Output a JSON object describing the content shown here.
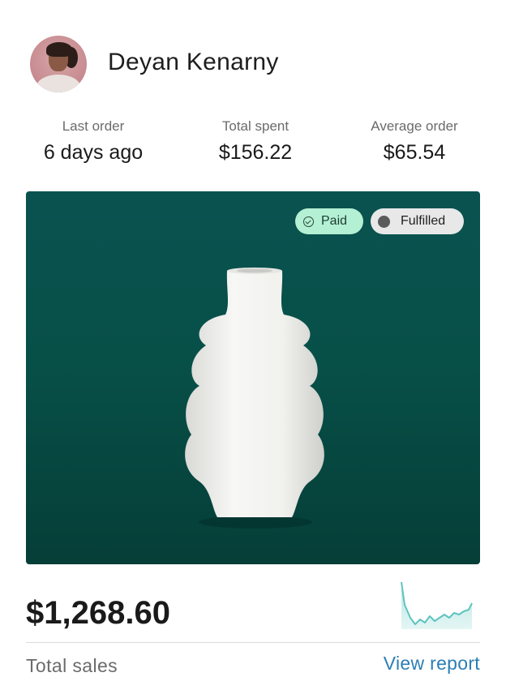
{
  "customer": {
    "name": "Deyan Kenarny",
    "avatar_icon": "person-avatar"
  },
  "stats": [
    {
      "label": "Last order",
      "value": "6 days ago"
    },
    {
      "label": "Total spent",
      "value": "$156.22"
    },
    {
      "label": "Average order",
      "value": "$65.54"
    }
  ],
  "order": {
    "badges": [
      {
        "label": "Paid",
        "icon": "check-circle-icon",
        "color": "#b4f0d4"
      },
      {
        "label": "Fulfilled",
        "icon": "dot-icon",
        "color": "#e8e8e8"
      }
    ],
    "image": "white-ceramic-vase",
    "background_color": "#075048"
  },
  "sales": {
    "total_value": "$1,268.60",
    "total_label": "Total sales",
    "report_link": "View report",
    "sparkline_color": "#5ec4c0",
    "accent_color": "#2a7fb5"
  }
}
